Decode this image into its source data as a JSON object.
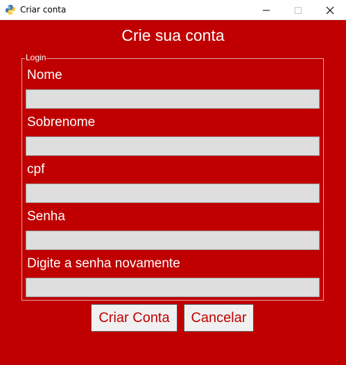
{
  "window": {
    "title": "Criar conta",
    "icon": "python-icon",
    "controls": [
      "minimize",
      "maximize",
      "close"
    ]
  },
  "form": {
    "heading": "Crie sua conta",
    "group_label": "Login",
    "fields": [
      {
        "label": "Nome",
        "value": ""
      },
      {
        "label": "Sobrenome",
        "value": ""
      },
      {
        "label": "cpf",
        "value": ""
      },
      {
        "label": "Senha",
        "value": ""
      },
      {
        "label": "Digite a senha novamente",
        "value": ""
      }
    ],
    "create_label": "Criar Conta",
    "cancel_label": "Cancelar"
  },
  "colors": {
    "background": "#c00000",
    "input_background": "#dedede",
    "button_background": "#f0f0f0",
    "button_text": "#c00000",
    "text": "#ffffff"
  }
}
